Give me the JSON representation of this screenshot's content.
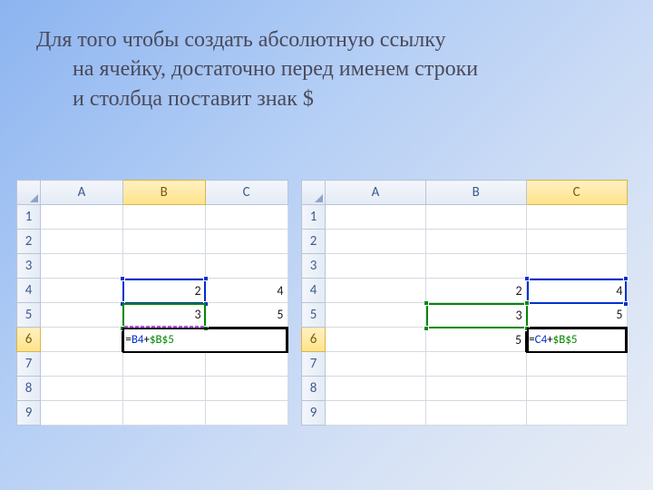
{
  "title": {
    "line1": "Для того чтобы создать абсолютную ссылку",
    "line2": "на ячейку, достаточно перед именем строки",
    "line3": "и столбца поставит знак $"
  },
  "left": {
    "cols": [
      "A",
      "B",
      "C"
    ],
    "rows": [
      "1",
      "2",
      "3",
      "4",
      "5",
      "6",
      "7",
      "8",
      "9"
    ],
    "active_col": "B",
    "active_row": "6",
    "cells": {
      "B4": "2",
      "C4": "4",
      "B5": "3",
      "C5": "5"
    },
    "formula": {
      "prefix": "=",
      "ref1": "B4",
      "op": "+",
      "ref2": "$B$5"
    }
  },
  "right": {
    "cols": [
      "A",
      "B",
      "C"
    ],
    "rows": [
      "1",
      "2",
      "3",
      "4",
      "5",
      "6",
      "7",
      "8",
      "9"
    ],
    "active_col": "C",
    "active_row": "6",
    "cells": {
      "B4": "2",
      "C4": "4",
      "B5": "3",
      "C5": "5",
      "B6": "5"
    },
    "formula": {
      "prefix": "=",
      "ref1": "C4",
      "op": "+",
      "ref2": "$B$5"
    }
  }
}
